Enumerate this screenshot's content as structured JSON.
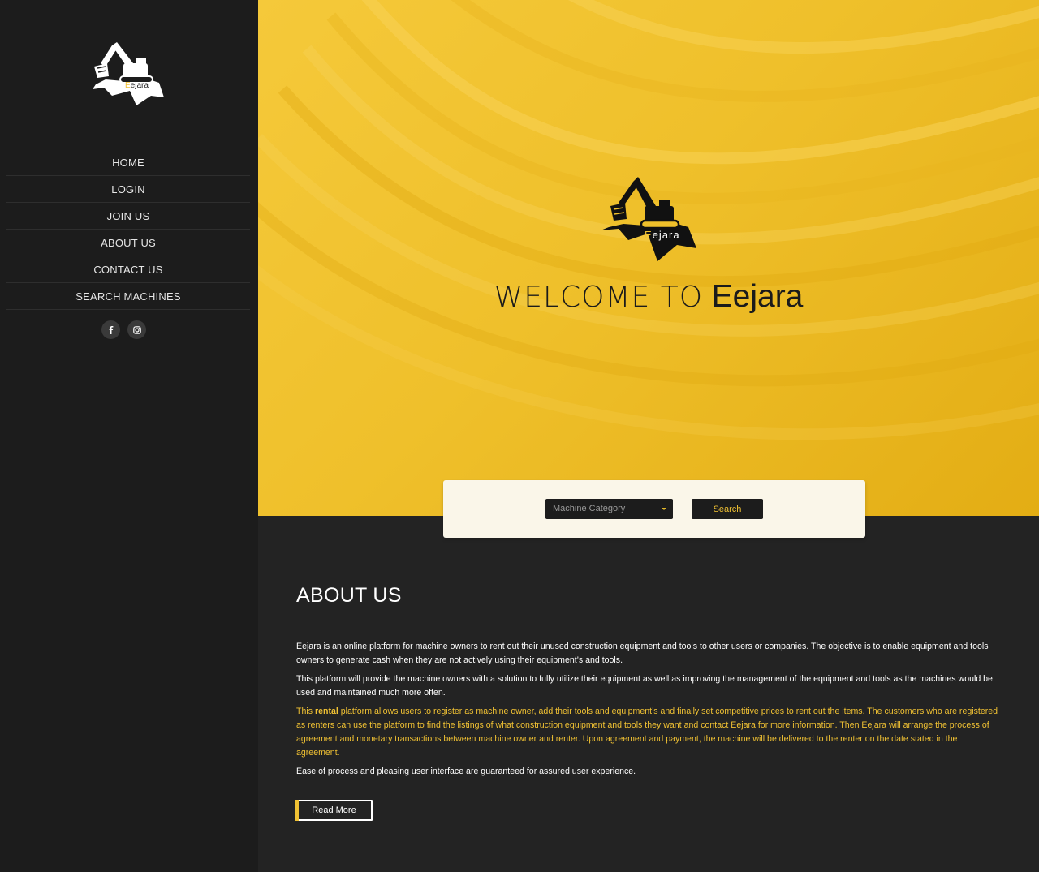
{
  "brand": {
    "name": "Eejara",
    "accent_color": "#f0c133",
    "logo_icon": "excavator-logo-icon"
  },
  "sidebar": {
    "nav": [
      {
        "label": "HOME"
      },
      {
        "label": "LOGIN"
      },
      {
        "label": "JOIN US"
      },
      {
        "label": "ABOUT US"
      },
      {
        "label": "CONTACT US"
      },
      {
        "label": "SEARCH MACHINES"
      }
    ],
    "social": [
      {
        "icon": "facebook-icon"
      },
      {
        "icon": "instagram-icon"
      }
    ]
  },
  "hero": {
    "title_prefix": "WELCOME TO",
    "title_brand": "Eejara",
    "background_color": "#efc02b"
  },
  "search": {
    "select_value": "Machine Category",
    "button_label": "Search"
  },
  "about": {
    "heading": "ABOUT US",
    "p1": "Eejara is an online platform for machine owners to rent out their unused construction equipment and tools to other users or companies. The objective is to enable equipment and tools owners to generate cash when they are not actively using their equipment’s and tools.",
    "p2": "This platform will provide the machine owners with a solution to fully utilize their equipment as well as improving the management of the equipment and tools as the machines would be used and maintained much more often.",
    "p3_pre": "This ",
    "p3_bold": "rental",
    "p3_post": " platform allows users to register as machine owner, add their tools and equipment’s and finally set competitive prices to rent out the items. The customers who are registered as renters can use the platform to find the listings of what construction equipment and tools they want and contact Eejara for more information. Then Eejara will arrange the process of agreement and monetary transactions between machine owner and renter. Upon agreement and payment, the machine will be delivered to the renter on the date stated in the agreement.",
    "p4": "Ease of process and pleasing user interface are guaranteed for assured user experience.",
    "read_more_label": "Read More"
  }
}
